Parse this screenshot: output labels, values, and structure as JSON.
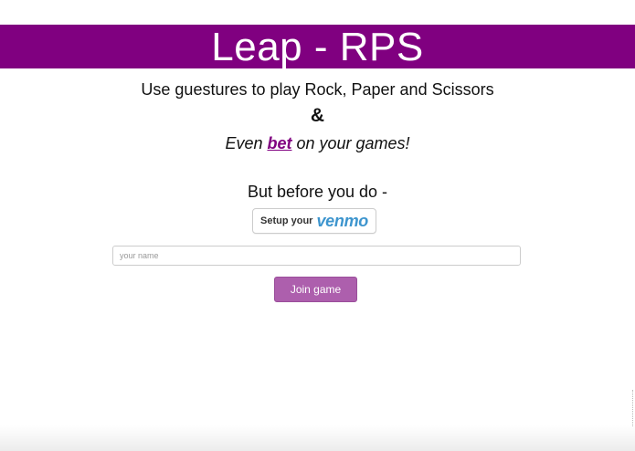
{
  "header": {
    "title": "Leap - RPS",
    "background_color": "#800080"
  },
  "intro": {
    "tagline": "Use guestures to play Rock, Paper and Scissors",
    "ampersand": "&",
    "bet_prefix": "Even ",
    "bet_link": "bet",
    "bet_suffix": " on your games!",
    "before": "But before you do -"
  },
  "venmo": {
    "prefix": "Setup your",
    "logo_text": "venmo",
    "logo_color": "#3d95ce"
  },
  "form": {
    "name_placeholder": "your name",
    "name_value": "",
    "join_label": "Join game",
    "join_color": "#ad5fad"
  }
}
